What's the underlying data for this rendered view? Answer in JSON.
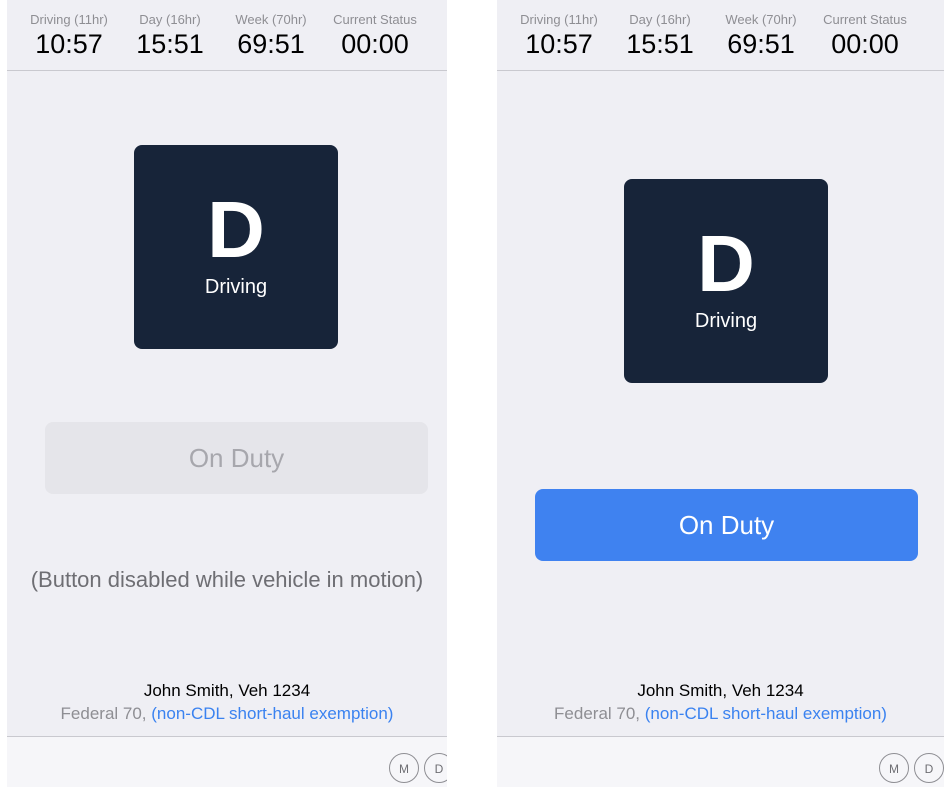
{
  "screens": [
    {
      "stats": [
        {
          "label": "Driving (11hr)",
          "value": "10:57"
        },
        {
          "label": "Day (16hr)",
          "value": "15:51"
        },
        {
          "label": "Week (70hr)",
          "value": "69:51"
        },
        {
          "label": "Current Status",
          "value": "00:00"
        }
      ],
      "status": {
        "letter": "D",
        "label": "Driving"
      },
      "duty_button": {
        "label": "On Duty",
        "enabled": false
      },
      "disabled_note": "(Button disabled while vehicle in motion)",
      "driver": {
        "name": "John Smith, Veh 1234",
        "rule": "Federal 70, ",
        "exemption": "(non-CDL short-haul exemption)"
      },
      "bottom_buttons": [
        "M",
        "D"
      ]
    },
    {
      "stats": [
        {
          "label": "Driving (11hr)",
          "value": "10:57"
        },
        {
          "label": "Day (16hr)",
          "value": "15:51"
        },
        {
          "label": "Week (70hr)",
          "value": "69:51"
        },
        {
          "label": "Current Status",
          "value": "00:00"
        }
      ],
      "status": {
        "letter": "D",
        "label": "Driving"
      },
      "duty_button": {
        "label": "On Duty",
        "enabled": true
      },
      "driver": {
        "name": "John Smith, Veh 1234",
        "rule": "Federal 70, ",
        "exemption": "(non-CDL short-haul exemption)"
      },
      "bottom_buttons": [
        "M",
        "D"
      ]
    }
  ],
  "colors": {
    "status_card": "#172439",
    "button_enabled": "#3f82f0",
    "button_disabled": "#e5e5ea",
    "link": "#3a82f0",
    "background": "#efeff4"
  }
}
